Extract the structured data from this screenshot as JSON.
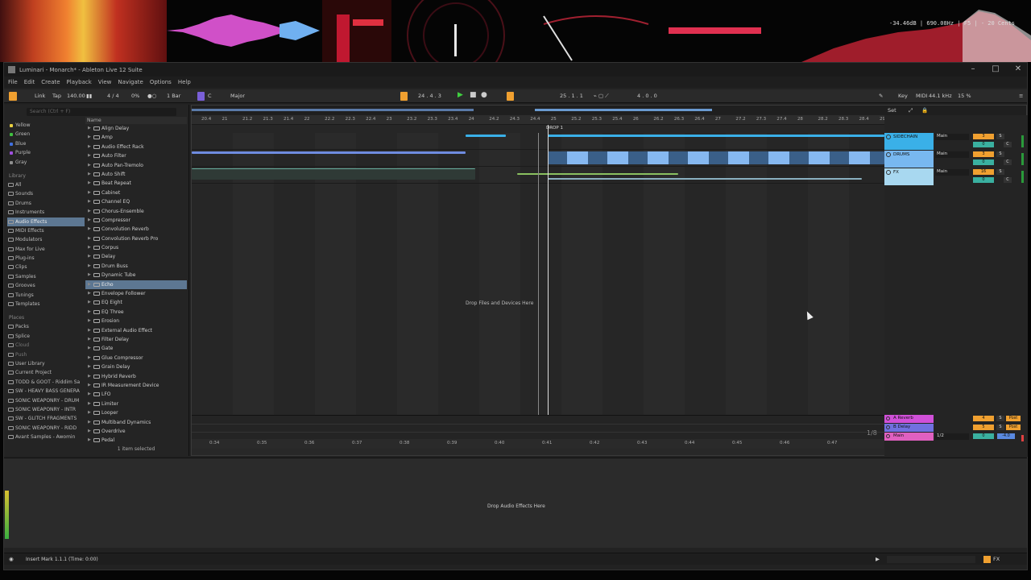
{
  "visualizer": {
    "readout_db": "-34.46dB",
    "readout_hz": "690.08Hz",
    "readout_note": "F5",
    "readout_cents": "- 20 Cents",
    "colors": {
      "bg": "#050505",
      "red": "#e83050",
      "magenta": "#e040c0"
    }
  },
  "window": {
    "title": "Luminari - Monarch* - Ableton Live 12 Suite",
    "minimize_icon": "minimize-icon",
    "maximize_icon": "maximize-icon",
    "close_icon": "close-icon"
  },
  "menu": [
    "File",
    "Edit",
    "Create",
    "Playback",
    "View",
    "Navigate",
    "Options",
    "Help"
  ],
  "transport": {
    "link": "Link",
    "tap": "Tap",
    "tempo": "140.00",
    "signature": "4 / 4",
    "groove": "0%",
    "quantize": "1 Bar",
    "key": "C",
    "scale": "Major",
    "position": "24 .  4 .  3",
    "loop_start": "25 .  1 .  1",
    "loop_length": "4 .  0 .  0",
    "key_button": "Key",
    "midi": "MIDI",
    "sample_rate": "44.1 kHz",
    "cpu": "15 %",
    "accent": "#f0a030"
  },
  "browser": {
    "search_placeholder": "Search (Ctrl + F)",
    "collections": [
      {
        "label": "Yellow",
        "color": "#e8d040"
      },
      {
        "label": "Green",
        "color": "#40c040"
      },
      {
        "label": "Blue",
        "color": "#4070e0"
      },
      {
        "label": "Purple",
        "color": "#a050e0"
      },
      {
        "label": "Gray",
        "color": "#909090"
      }
    ],
    "library_head": "Library",
    "library": [
      "All",
      "Sounds",
      "Drums",
      "Instruments",
      "Audio Effects",
      "MIDI Effects",
      "Modulators",
      "Max for Live",
      "Plug-ins",
      "Clips",
      "Samples",
      "Grooves",
      "Tunings",
      "Templates"
    ],
    "selected_library": "Audio Effects",
    "places_head": "Places",
    "places": [
      "Packs",
      "Splice",
      "Cloud",
      "Push",
      "User Library",
      "Current Project",
      "TODD & GOOT - Riddim Sa",
      "SW - HEAVY BASS GENERA",
      "SONIC WEAPONRY - DRUM",
      "SONIC WEAPONRY - INTR",
      "SW - GLITCH FRAGMENTS",
      "SONIC WEAPONRY - RIDD",
      "Avant Samples - Awomin"
    ],
    "name_head": "Name",
    "items": [
      "Align Delay",
      "Amp",
      "Audio Effect Rack",
      "Auto Filter",
      "Auto Pan-Tremolo",
      "Auto Shift",
      "Beat Repeat",
      "Cabinet",
      "Channel EQ",
      "Chorus-Ensemble",
      "Compressor",
      "Convolution Reverb",
      "Convolution Reverb Pro",
      "Corpus",
      "Delay",
      "Drum Buss",
      "Dynamic Tube",
      "Echo",
      "Envelope Follower",
      "EQ Eight",
      "EQ Three",
      "Erosion",
      "External Audio Effect",
      "Filter Delay",
      "Gate",
      "Glue Compressor",
      "Grain Delay",
      "Hybrid Reverb",
      "IR Measurement Device",
      "LFO",
      "Limiter",
      "Looper",
      "Multiband Dynamics",
      "Overdrive",
      "Pedal"
    ],
    "selected_item": "Echo",
    "status": "1 item selected"
  },
  "arrangement": {
    "bar_ticks": [
      "20.4",
      "21",
      "21.2",
      "21.3",
      "21.4",
      "22",
      "22.2",
      "22.3",
      "22.4",
      "23",
      "23.2",
      "23.3",
      "23.4",
      "24",
      "24.2",
      "24.3",
      "24.4",
      "25",
      "25.2",
      "25.3",
      "25.4",
      "26",
      "26.2",
      "26.3",
      "26.4",
      "27",
      "27.2",
      "27.3",
      "27.4",
      "28",
      "28.2",
      "28.3",
      "28.4",
      "29"
    ],
    "locator": "DROP 1",
    "drop_text": "Drop Files and Devices Here",
    "time_ticks": [
      "0:34",
      "0:35",
      "0:36",
      "0:37",
      "0:38",
      "0:39",
      "0:40",
      "0:41",
      "0:42",
      "0:43",
      "0:44",
      "0:45",
      "0:46",
      "0:47"
    ],
    "zoom_fraction": "1/8",
    "set_label": "Set"
  },
  "tracks": [
    {
      "name": "SIDECHAIN",
      "color": "#3ab0e8",
      "route": "Main",
      "vol": "3",
      "send": "S",
      "pan": "0",
      "pan_c": "C",
      "vol_color": "#f0a030"
    },
    {
      "name": "DRUMS",
      "color": "#78b8f0",
      "route": "Main",
      "vol": "3",
      "send": "S",
      "pan": "0",
      "pan_c": "C",
      "vol_color": "#f0a030"
    },
    {
      "name": "FX",
      "color": "#a8d8f0",
      "route": "Main",
      "vol": "16",
      "send": "S",
      "pan": "0",
      "pan_c": "C",
      "vol_color": "#f0a030"
    }
  ],
  "returns": [
    {
      "name": "A Reverb",
      "color": "#d050d8",
      "vol": "4",
      "send": "S",
      "post": "Post"
    },
    {
      "name": "B Delay",
      "color": "#7070e0",
      "vol": "5",
      "send": "S",
      "post": "Post"
    },
    {
      "name": "Main",
      "color": "#e060c0",
      "route": "1/2",
      "vol": "0",
      "pan": "-4.0"
    }
  ],
  "device": {
    "drop_text": "Drop Audio Effects Here"
  },
  "status": {
    "message": "Insert Mark 1.1.1 (Time: 0:00)",
    "fx": "FX"
  }
}
